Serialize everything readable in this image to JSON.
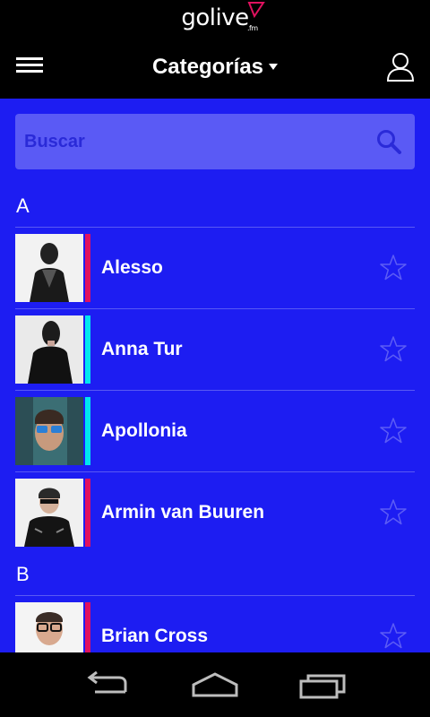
{
  "app": {
    "logo_text": "golive",
    "logo_sub": ".fm"
  },
  "header": {
    "title": "Categorías"
  },
  "search": {
    "placeholder": "Buscar"
  },
  "colors": {
    "background": "#1d1df2",
    "accent_red": "#e0115f",
    "accent_cyan": "#00e6f0"
  },
  "sections": [
    {
      "letter": "A",
      "artists": [
        {
          "name": "Alesso",
          "accent": "#e0115f",
          "icon": "star-icon"
        },
        {
          "name": "Anna Tur",
          "accent": "#00e6f0",
          "icon": "star-icon"
        },
        {
          "name": "Apollonia",
          "accent": "#00e6f0",
          "icon": "star-icon"
        },
        {
          "name": "Armin van Buuren",
          "accent": "#e0115f",
          "icon": "star-icon"
        }
      ]
    },
    {
      "letter": "B",
      "artists": [
        {
          "name": "Brian Cross",
          "accent": "#e0115f",
          "icon": "star-icon"
        }
      ]
    }
  ],
  "nav": {
    "icons": [
      "back-icon",
      "home-icon",
      "recent-apps-icon"
    ]
  }
}
